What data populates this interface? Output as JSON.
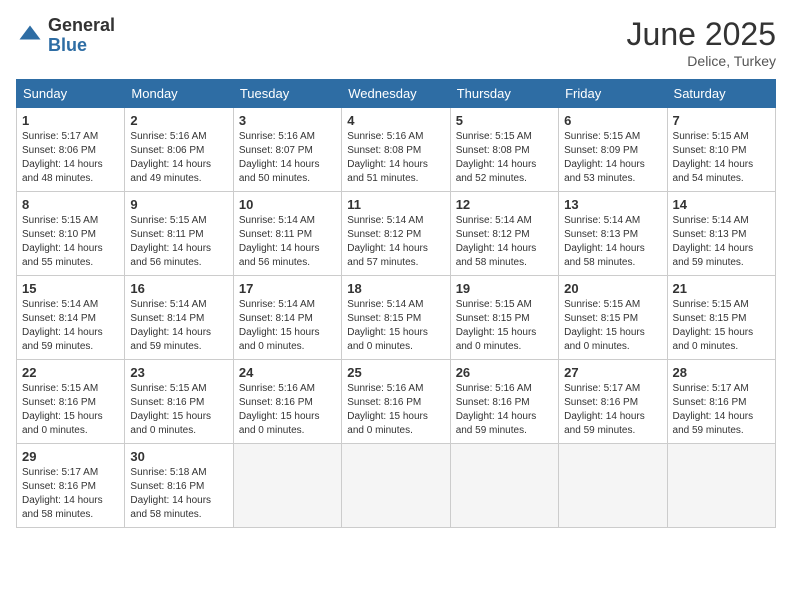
{
  "header": {
    "logo_general": "General",
    "logo_blue": "Blue",
    "month_title": "June 2025",
    "location": "Delice, Turkey"
  },
  "calendar": {
    "days_of_week": [
      "Sunday",
      "Monday",
      "Tuesday",
      "Wednesday",
      "Thursday",
      "Friday",
      "Saturday"
    ],
    "weeks": [
      [
        {
          "day": "",
          "info": ""
        },
        {
          "day": "2",
          "info": "Sunrise: 5:16 AM\nSunset: 8:06 PM\nDaylight: 14 hours\nand 49 minutes."
        },
        {
          "day": "3",
          "info": "Sunrise: 5:16 AM\nSunset: 8:07 PM\nDaylight: 14 hours\nand 50 minutes."
        },
        {
          "day": "4",
          "info": "Sunrise: 5:16 AM\nSunset: 8:08 PM\nDaylight: 14 hours\nand 51 minutes."
        },
        {
          "day": "5",
          "info": "Sunrise: 5:15 AM\nSunset: 8:08 PM\nDaylight: 14 hours\nand 52 minutes."
        },
        {
          "day": "6",
          "info": "Sunrise: 5:15 AM\nSunset: 8:09 PM\nDaylight: 14 hours\nand 53 minutes."
        },
        {
          "day": "7",
          "info": "Sunrise: 5:15 AM\nSunset: 8:10 PM\nDaylight: 14 hours\nand 54 minutes."
        }
      ],
      [
        {
          "day": "1",
          "info": "Sunrise: 5:17 AM\nSunset: 8:06 PM\nDaylight: 14 hours\nand 48 minutes."
        },
        {
          "day": "",
          "info": ""
        },
        {
          "day": "",
          "info": ""
        },
        {
          "day": "",
          "info": ""
        },
        {
          "day": "",
          "info": ""
        },
        {
          "day": "",
          "info": ""
        },
        {
          "day": "",
          "info": ""
        }
      ],
      [
        {
          "day": "8",
          "info": "Sunrise: 5:15 AM\nSunset: 8:10 PM\nDaylight: 14 hours\nand 55 minutes."
        },
        {
          "day": "9",
          "info": "Sunrise: 5:15 AM\nSunset: 8:11 PM\nDaylight: 14 hours\nand 56 minutes."
        },
        {
          "day": "10",
          "info": "Sunrise: 5:14 AM\nSunset: 8:11 PM\nDaylight: 14 hours\nand 56 minutes."
        },
        {
          "day": "11",
          "info": "Sunrise: 5:14 AM\nSunset: 8:12 PM\nDaylight: 14 hours\nand 57 minutes."
        },
        {
          "day": "12",
          "info": "Sunrise: 5:14 AM\nSunset: 8:12 PM\nDaylight: 14 hours\nand 58 minutes."
        },
        {
          "day": "13",
          "info": "Sunrise: 5:14 AM\nSunset: 8:13 PM\nDaylight: 14 hours\nand 58 minutes."
        },
        {
          "day": "14",
          "info": "Sunrise: 5:14 AM\nSunset: 8:13 PM\nDaylight: 14 hours\nand 59 minutes."
        }
      ],
      [
        {
          "day": "15",
          "info": "Sunrise: 5:14 AM\nSunset: 8:14 PM\nDaylight: 14 hours\nand 59 minutes."
        },
        {
          "day": "16",
          "info": "Sunrise: 5:14 AM\nSunset: 8:14 PM\nDaylight: 14 hours\nand 59 minutes."
        },
        {
          "day": "17",
          "info": "Sunrise: 5:14 AM\nSunset: 8:14 PM\nDaylight: 15 hours\nand 0 minutes."
        },
        {
          "day": "18",
          "info": "Sunrise: 5:14 AM\nSunset: 8:15 PM\nDaylight: 15 hours\nand 0 minutes."
        },
        {
          "day": "19",
          "info": "Sunrise: 5:15 AM\nSunset: 8:15 PM\nDaylight: 15 hours\nand 0 minutes."
        },
        {
          "day": "20",
          "info": "Sunrise: 5:15 AM\nSunset: 8:15 PM\nDaylight: 15 hours\nand 0 minutes."
        },
        {
          "day": "21",
          "info": "Sunrise: 5:15 AM\nSunset: 8:15 PM\nDaylight: 15 hours\nand 0 minutes."
        }
      ],
      [
        {
          "day": "22",
          "info": "Sunrise: 5:15 AM\nSunset: 8:16 PM\nDaylight: 15 hours\nand 0 minutes."
        },
        {
          "day": "23",
          "info": "Sunrise: 5:15 AM\nSunset: 8:16 PM\nDaylight: 15 hours\nand 0 minutes."
        },
        {
          "day": "24",
          "info": "Sunrise: 5:16 AM\nSunset: 8:16 PM\nDaylight: 15 hours\nand 0 minutes."
        },
        {
          "day": "25",
          "info": "Sunrise: 5:16 AM\nSunset: 8:16 PM\nDaylight: 15 hours\nand 0 minutes."
        },
        {
          "day": "26",
          "info": "Sunrise: 5:16 AM\nSunset: 8:16 PM\nDaylight: 14 hours\nand 59 minutes."
        },
        {
          "day": "27",
          "info": "Sunrise: 5:17 AM\nSunset: 8:16 PM\nDaylight: 14 hours\nand 59 minutes."
        },
        {
          "day": "28",
          "info": "Sunrise: 5:17 AM\nSunset: 8:16 PM\nDaylight: 14 hours\nand 59 minutes."
        }
      ],
      [
        {
          "day": "29",
          "info": "Sunrise: 5:17 AM\nSunset: 8:16 PM\nDaylight: 14 hours\nand 58 minutes."
        },
        {
          "day": "30",
          "info": "Sunrise: 5:18 AM\nSunset: 8:16 PM\nDaylight: 14 hours\nand 58 minutes."
        },
        {
          "day": "",
          "info": ""
        },
        {
          "day": "",
          "info": ""
        },
        {
          "day": "",
          "info": ""
        },
        {
          "day": "",
          "info": ""
        },
        {
          "day": "",
          "info": ""
        }
      ]
    ]
  }
}
